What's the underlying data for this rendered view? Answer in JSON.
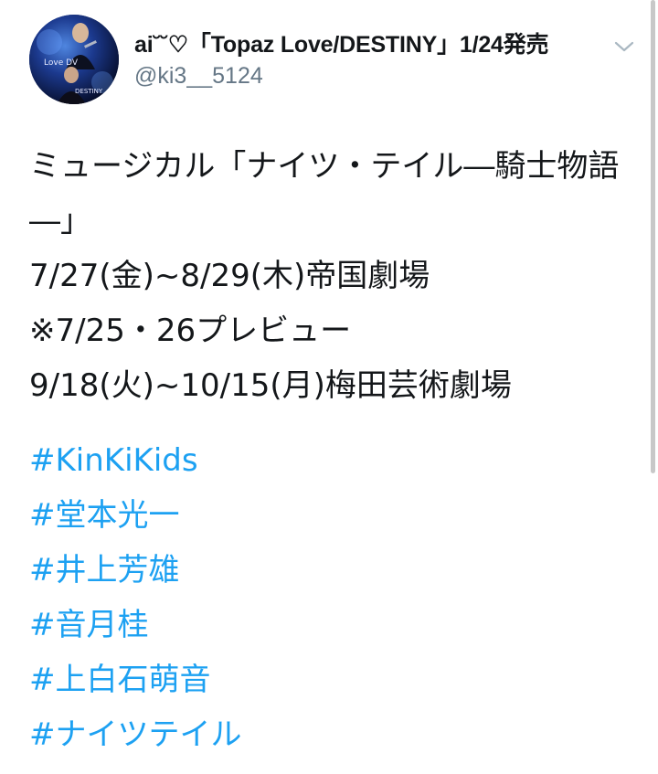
{
  "tweet": {
    "author": {
      "display_name": "ai˘˘♡「Topaz Love/DESTINY」1/24発売",
      "handle": "@ki3__5124",
      "avatar_text_top": "Love DV",
      "avatar_text_bottom": "DESTINY"
    },
    "menu_icon": "chevron-down-icon",
    "text_lines": [
      "ミュージカル「ナイツ・テイル―騎士物語",
      "―」"
    ],
    "schedule_lines": [
      "7/27(金)~8/29(木)帝国劇場",
      "※7/25・26プレビュー",
      "9/18(火)~10/15(月)梅田芸術劇場"
    ],
    "hashtags": [
      "#KinKiKids",
      "#堂本光一",
      "#井上芳雄",
      "#音月桂",
      "#上白石萌音",
      "#ナイツテイル"
    ]
  },
  "colors": {
    "text": "#14171a",
    "secondary": "#657786",
    "link": "#1da1f2",
    "background": "#ffffff"
  }
}
